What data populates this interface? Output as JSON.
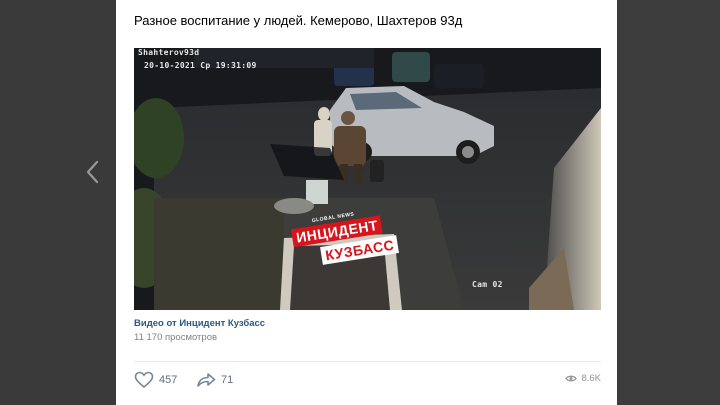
{
  "post": {
    "text": "Разное воспитание у людей. Кемерово, Шахтеров 93д"
  },
  "video": {
    "camera_name": "Shahterov93d",
    "timestamp": "20-10-2021 Ср 19:31:09",
    "camera_id": "Cam 02",
    "logo": {
      "small": "GLOBAL NEWS",
      "line1": "ИНЦИДЕНТ",
      "line2": "КУЗБАСС"
    }
  },
  "source": {
    "title": "Видео от Инцидент Кузбасс",
    "views": "11 170 просмотров"
  },
  "actions": {
    "likes": "457",
    "shares": "71",
    "view_count": "8.6K"
  },
  "icons": [
    "chevron-left-icon",
    "heart-icon",
    "share-icon",
    "eye-icon"
  ],
  "colors": {
    "link": "#2a5885",
    "muted": "#828282",
    "logo_red": "#d8141c",
    "background": "#3a3a3a"
  }
}
